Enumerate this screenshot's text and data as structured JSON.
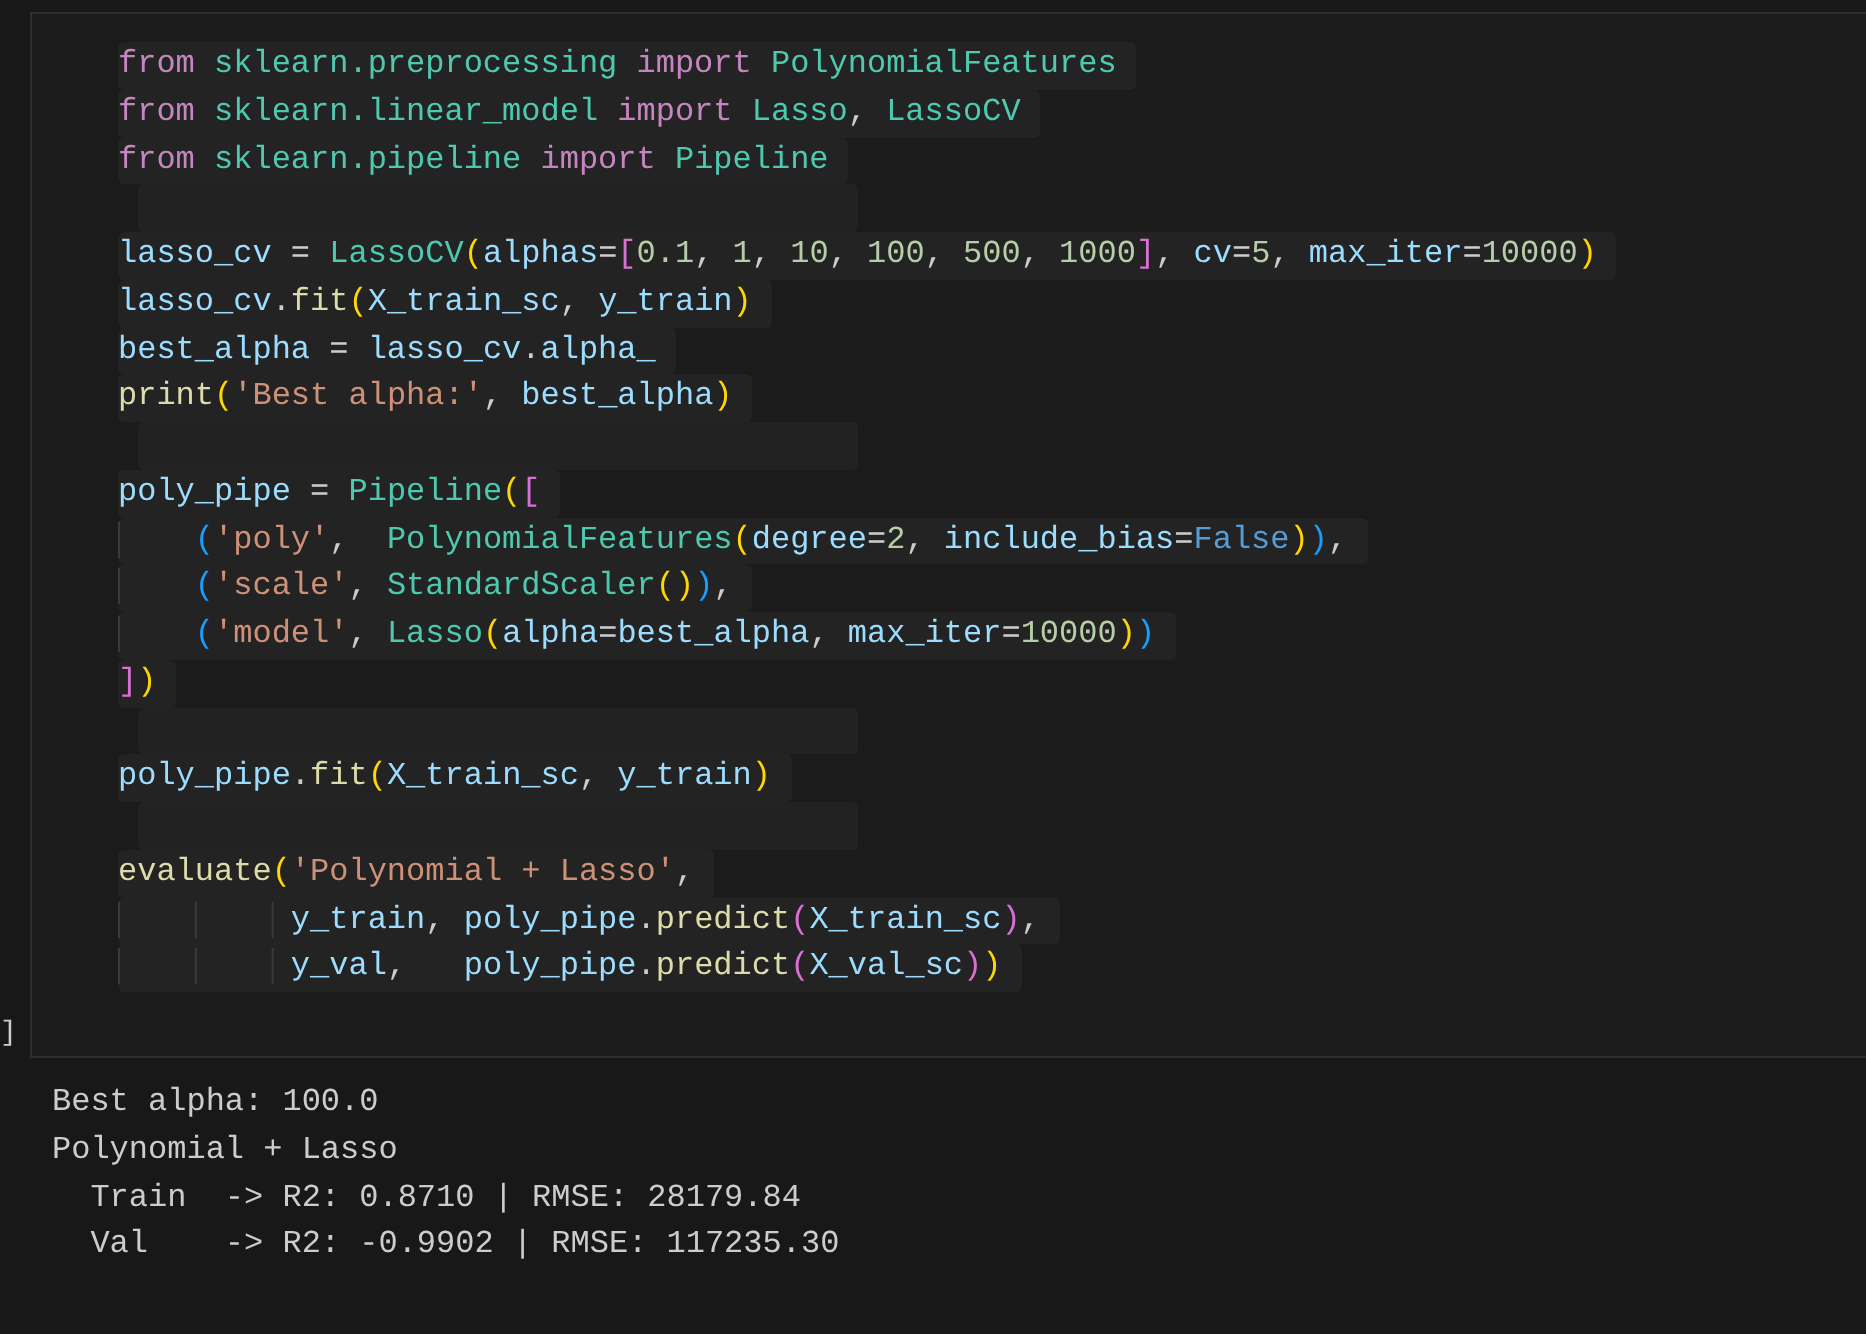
{
  "cell": {
    "bracket": "]",
    "lines": [
      {
        "kind": "code",
        "tokens": [
          {
            "text": "from",
            "kind": "keyword"
          },
          {
            "text": " sklearn.preprocessing",
            "kind": "module"
          },
          {
            "text": " import",
            "kind": "keyword"
          },
          {
            "text": " PolynomialFeatures",
            "kind": "module"
          }
        ]
      },
      {
        "kind": "code",
        "tokens": [
          {
            "text": "from",
            "kind": "keyword"
          },
          {
            "text": " sklearn.linear_model",
            "kind": "module"
          },
          {
            "text": " import",
            "kind": "keyword"
          },
          {
            "text": " Lasso",
            "kind": "module"
          },
          {
            "text": ", ",
            "kind": "plain"
          },
          {
            "text": "LassoCV",
            "kind": "module"
          }
        ]
      },
      {
        "kind": "code",
        "tokens": [
          {
            "text": "from",
            "kind": "keyword"
          },
          {
            "text": " sklearn.pipeline",
            "kind": "module"
          },
          {
            "text": " import",
            "kind": "keyword"
          },
          {
            "text": " Pipeline",
            "kind": "module"
          }
        ]
      },
      {
        "kind": "blank"
      },
      {
        "kind": "code",
        "tokens": [
          {
            "text": "lasso_cv",
            "kind": "variable"
          },
          {
            "text": " = ",
            "kind": "plain"
          },
          {
            "text": "LassoCV",
            "kind": "module"
          },
          {
            "text": "(",
            "kind": "bracket1"
          },
          {
            "text": "alphas",
            "kind": "variable"
          },
          {
            "text": "=",
            "kind": "plain"
          },
          {
            "text": "[",
            "kind": "bracket2"
          },
          {
            "text": "0.1",
            "kind": "number"
          },
          {
            "text": ", ",
            "kind": "plain"
          },
          {
            "text": "1",
            "kind": "number"
          },
          {
            "text": ", ",
            "kind": "plain"
          },
          {
            "text": "10",
            "kind": "number"
          },
          {
            "text": ", ",
            "kind": "plain"
          },
          {
            "text": "100",
            "kind": "number"
          },
          {
            "text": ", ",
            "kind": "plain"
          },
          {
            "text": "500",
            "kind": "number"
          },
          {
            "text": ", ",
            "kind": "plain"
          },
          {
            "text": "1000",
            "kind": "number"
          },
          {
            "text": "]",
            "kind": "bracket2"
          },
          {
            "text": ", ",
            "kind": "plain"
          },
          {
            "text": "cv",
            "kind": "variable"
          },
          {
            "text": "=",
            "kind": "plain"
          },
          {
            "text": "5",
            "kind": "number"
          },
          {
            "text": ", ",
            "kind": "plain"
          },
          {
            "text": "max_iter",
            "kind": "variable"
          },
          {
            "text": "=",
            "kind": "plain"
          },
          {
            "text": "10000",
            "kind": "number"
          },
          {
            "text": ")",
            "kind": "bracket1"
          }
        ]
      },
      {
        "kind": "code",
        "tokens": [
          {
            "text": "lasso_cv",
            "kind": "variable"
          },
          {
            "text": ".",
            "kind": "plain"
          },
          {
            "text": "fit",
            "kind": "function"
          },
          {
            "text": "(",
            "kind": "bracket1"
          },
          {
            "text": "X_train_sc",
            "kind": "variable"
          },
          {
            "text": ", ",
            "kind": "plain"
          },
          {
            "text": "y_train",
            "kind": "variable"
          },
          {
            "text": ")",
            "kind": "bracket1"
          }
        ]
      },
      {
        "kind": "code",
        "tokens": [
          {
            "text": "best_alpha",
            "kind": "variable"
          },
          {
            "text": " = ",
            "kind": "plain"
          },
          {
            "text": "lasso_cv",
            "kind": "variable"
          },
          {
            "text": ".",
            "kind": "plain"
          },
          {
            "text": "alpha_",
            "kind": "variable"
          }
        ]
      },
      {
        "kind": "code",
        "tokens": [
          {
            "text": "print",
            "kind": "function"
          },
          {
            "text": "(",
            "kind": "bracket1"
          },
          {
            "text": "'Best alpha:'",
            "kind": "string"
          },
          {
            "text": ", ",
            "kind": "plain"
          },
          {
            "text": "best_alpha",
            "kind": "variable"
          },
          {
            "text": ")",
            "kind": "bracket1"
          }
        ]
      },
      {
        "kind": "blank"
      },
      {
        "kind": "code",
        "tokens": [
          {
            "text": "poly_pipe",
            "kind": "variable"
          },
          {
            "text": " = ",
            "kind": "plain"
          },
          {
            "text": "Pipeline",
            "kind": "module"
          },
          {
            "text": "(",
            "kind": "bracket1"
          },
          {
            "text": "[",
            "kind": "bracket2"
          }
        ]
      },
      {
        "kind": "code",
        "tokens": [
          {
            "text": "    (",
            "kind": "bracket3"
          },
          {
            "text": "'poly'",
            "kind": "string"
          },
          {
            "text": ",  ",
            "kind": "plain"
          },
          {
            "text": "PolynomialFeatures",
            "kind": "module"
          },
          {
            "text": "(",
            "kind": "bracket1"
          },
          {
            "text": "degree",
            "kind": "variable"
          },
          {
            "text": "=",
            "kind": "plain"
          },
          {
            "text": "2",
            "kind": "number"
          },
          {
            "text": ", ",
            "kind": "plain"
          },
          {
            "text": "include_bias",
            "kind": "variable"
          },
          {
            "text": "=",
            "kind": "plain"
          },
          {
            "text": "False",
            "kind": "constant"
          },
          {
            "text": ")",
            "kind": "bracket1"
          },
          {
            "text": ")",
            "kind": "bracket3"
          },
          {
            "text": ",",
            "kind": "plain"
          }
        ]
      },
      {
        "kind": "code",
        "tokens": [
          {
            "text": "    (",
            "kind": "bracket3"
          },
          {
            "text": "'scale'",
            "kind": "string"
          },
          {
            "text": ", ",
            "kind": "plain"
          },
          {
            "text": "StandardScaler",
            "kind": "module"
          },
          {
            "text": "(",
            "kind": "bracket1"
          },
          {
            "text": ")",
            "kind": "bracket1"
          },
          {
            "text": ")",
            "kind": "bracket3"
          },
          {
            "text": ",",
            "kind": "plain"
          }
        ]
      },
      {
        "kind": "code",
        "tokens": [
          {
            "text": "    (",
            "kind": "bracket3"
          },
          {
            "text": "'model'",
            "kind": "string"
          },
          {
            "text": ", ",
            "kind": "plain"
          },
          {
            "text": "Lasso",
            "kind": "module"
          },
          {
            "text": "(",
            "kind": "bracket1"
          },
          {
            "text": "alpha",
            "kind": "variable"
          },
          {
            "text": "=",
            "kind": "plain"
          },
          {
            "text": "best_alpha",
            "kind": "variable"
          },
          {
            "text": ", ",
            "kind": "plain"
          },
          {
            "text": "max_iter",
            "kind": "variable"
          },
          {
            "text": "=",
            "kind": "plain"
          },
          {
            "text": "10000",
            "kind": "number"
          },
          {
            "text": ")",
            "kind": "bracket1"
          },
          {
            "text": ")",
            "kind": "bracket3"
          }
        ]
      },
      {
        "kind": "code",
        "tokens": [
          {
            "text": "]",
            "kind": "bracket2"
          },
          {
            "text": ")",
            "kind": "bracket1"
          }
        ]
      },
      {
        "kind": "blank"
      },
      {
        "kind": "code",
        "tokens": [
          {
            "text": "poly_pipe",
            "kind": "variable"
          },
          {
            "text": ".",
            "kind": "plain"
          },
          {
            "text": "fit",
            "kind": "function"
          },
          {
            "text": "(",
            "kind": "bracket1"
          },
          {
            "text": "X_train_sc",
            "kind": "variable"
          },
          {
            "text": ", ",
            "kind": "plain"
          },
          {
            "text": "y_train",
            "kind": "variable"
          },
          {
            "text": ")",
            "kind": "bracket1"
          }
        ]
      },
      {
        "kind": "blank"
      },
      {
        "kind": "code",
        "tokens": [
          {
            "text": "evaluate",
            "kind": "function"
          },
          {
            "text": "(",
            "kind": "bracket1"
          },
          {
            "text": "'Polynomial + Lasso'",
            "kind": "string"
          },
          {
            "text": ",",
            "kind": "plain"
          }
        ]
      },
      {
        "kind": "code",
        "tokens": [
          {
            "text": "         y_train",
            "kind": "variable"
          },
          {
            "text": ", ",
            "kind": "plain"
          },
          {
            "text": "poly_pipe",
            "kind": "variable"
          },
          {
            "text": ".",
            "kind": "plain"
          },
          {
            "text": "predict",
            "kind": "function"
          },
          {
            "text": "(",
            "kind": "bracket2"
          },
          {
            "text": "X_train_sc",
            "kind": "variable"
          },
          {
            "text": ")",
            "kind": "bracket2"
          },
          {
            "text": ",",
            "kind": "plain"
          }
        ]
      },
      {
        "kind": "code",
        "tokens": [
          {
            "text": "         y_val",
            "kind": "variable"
          },
          {
            "text": ",   ",
            "kind": "plain"
          },
          {
            "text": "poly_pipe",
            "kind": "variable"
          },
          {
            "text": ".",
            "kind": "plain"
          },
          {
            "text": "predict",
            "kind": "function"
          },
          {
            "text": "(",
            "kind": "bracket2"
          },
          {
            "text": "X_val_sc",
            "kind": "variable"
          },
          {
            "text": ")",
            "kind": "bracket2"
          },
          {
            "text": ")",
            "kind": "bracket1"
          }
        ]
      }
    ]
  },
  "output": [
    "Best alpha: 100.0",
    "Polynomial + Lasso",
    "  Train  -> R2: 0.8710 | RMSE: 28179.84",
    "  Val    -> R2: -0.9902 | RMSE: 117235.30"
  ]
}
